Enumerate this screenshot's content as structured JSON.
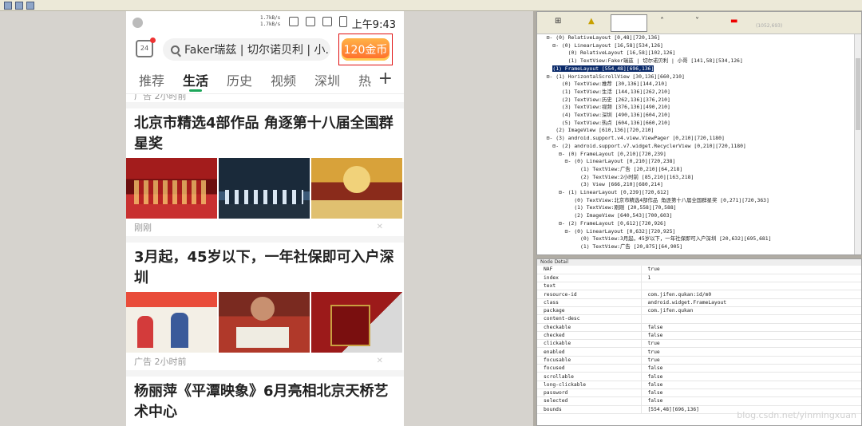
{
  "phone": {
    "status": {
      "speed_up": "1.7kB/s",
      "speed_down": "1.7kB/s",
      "time": "上午9:43"
    },
    "calendar_day": "24",
    "search_text": "Faker瑞兹 | 切尔诺贝利 | 小...",
    "gold_label": "120金币",
    "tabs": [
      "推荐",
      "生活",
      "历史",
      "视频",
      "深圳",
      "热"
    ],
    "active_tab": "生活",
    "feed": [
      {
        "meta_top": "广告  2小时前",
        "title": "北京市精选4部作品 角逐第十八届全国群星奖",
        "meta": "刚刚"
      },
      {
        "title": "3月起，45岁以下，一年社保即可入户深圳",
        "meta": "广告  2小时前"
      },
      {
        "title": "杨丽萍《平潭映象》6月亮相北京天桥艺术中心"
      }
    ]
  },
  "tree": {
    "coord_readout": "(1052,693)",
    "lines": [
      "  ⊟- (0) RelativeLayout [0,48][720,136]",
      "    ⊟- (0) LinearLayout [16,58][534,126]",
      "         (0) RelativeLayout [16,58][102,126]",
      "         (1) TextView:Faker瑞兹 | 切尔诺贝利 | 小哥 [141,58][534,126]",
      "    SEL",
      "  ⊟- (1) HorizontalScrollView [30,136][660,210]",
      "       (0) TextView:推荐 [30,136][144,210]",
      "       (1) TextView:生活 [144,136][262,210]",
      "       (2) TextView:历史 [262,136][376,210]",
      "       (3) TextView:视频 [376,136][490,210]",
      "       (4) TextView:深圳 [490,136][604,210]",
      "       (5) TextView:热点 [604,136][660,210]",
      "     (2) ImageView [610,136][720,210]",
      "  ⊟- (3) android.support.v4.view.ViewPager [0,210][720,1180]",
      "    ⊟- (2) android.support.v7.widget.RecyclerView [0,210][720,1180]",
      "      ⊟- (0) FrameLayout [0,210][720,239]",
      "        ⊟- (0) LinearLayout [0,210][720,238]",
      "             (1) TextView:广告 [20,210][64,218]",
      "             (2) TextView:2小时前 [85,210][163,218]",
      "             (3) View [666,210][680,214]",
      "      ⊟- (1) LinearLayout [0,239][720,612]",
      "           (0) TextView:北京市精选4部作品 角逐第十八届全国群星奖 [0,271][720,363]",
      "           (1) TextView:刚刚 [20,558][70,588]",
      "           (2) ImageView [640,543][700,603]",
      "      ⊟- (2) FrameLayout [0,612][720,926]",
      "        ⊟- (0) LinearLayout [0,632][720,925]",
      "             (0) TextView:3月起，45岁以下，一年社保即可入户深圳 [20,632][695,681]",
      "             (1) TextView:广告 [20,875][64,905]"
    ],
    "selected_line": "(1) FrameLayout [554,48][696,136]"
  },
  "detail": {
    "header": "Node Detail",
    "rows": [
      [
        "NAF",
        "true"
      ],
      [
        "index",
        "1"
      ],
      [
        "text",
        ""
      ],
      [
        "resource-id",
        "com.jifen.qukan:id/m0"
      ],
      [
        "class",
        "android.widget.FrameLayout"
      ],
      [
        "package",
        "com.jifen.qukan"
      ],
      [
        "content-desc",
        ""
      ],
      [
        "checkable",
        "false"
      ],
      [
        "checked",
        "false"
      ],
      [
        "clickable",
        "true"
      ],
      [
        "enabled",
        "true"
      ],
      [
        "focusable",
        "true"
      ],
      [
        "focused",
        "false"
      ],
      [
        "scrollable",
        "false"
      ],
      [
        "long-clickable",
        "false"
      ],
      [
        "password",
        "false"
      ],
      [
        "selected",
        "false"
      ],
      [
        "bounds",
        "[554,48][696,136]"
      ]
    ],
    "watermark": "blog.csdn.net/yinmingxuan"
  }
}
